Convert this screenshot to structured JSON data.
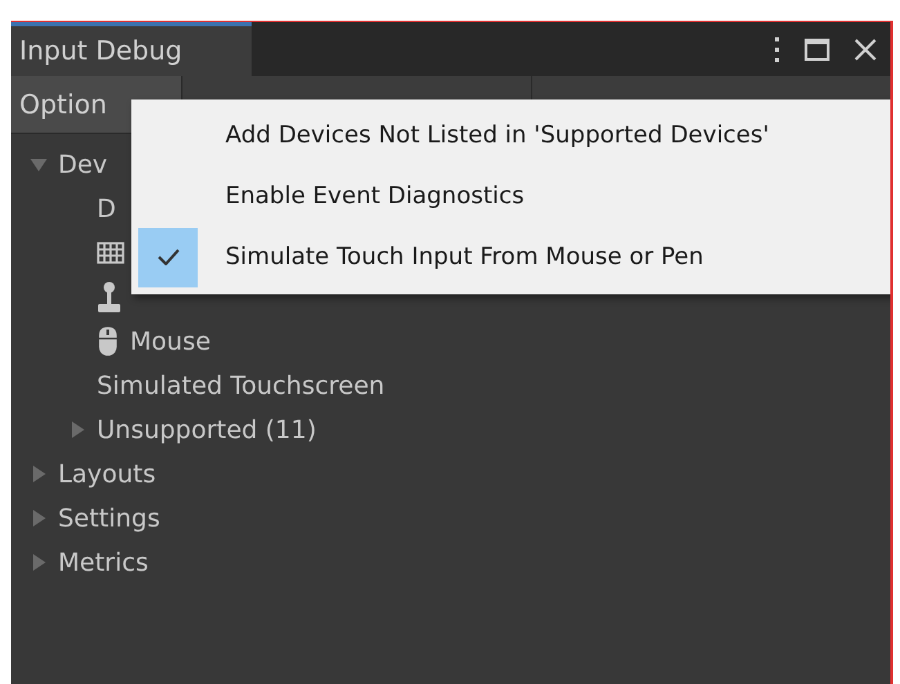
{
  "window": {
    "tab": "Input Debug"
  },
  "window_controls": [
    {
      "kind": "more"
    },
    {
      "kind": "maximize"
    },
    {
      "kind": "close"
    }
  ],
  "toolbar": {
    "buttons": [
      {
        "label": "Option"
      }
    ]
  },
  "tree": [
    {
      "label": "Dev",
      "expanded": true,
      "children": [
        {
          "label": "D"
        },
        {
          "kind": "keyboard"
        },
        {
          "kind": "joystick"
        },
        {
          "kind": "mouse",
          "label": "Mouse"
        },
        {
          "label": "Simulated Touchscreen"
        },
        {
          "label": "Unsupported (11)",
          "expanded": false
        }
      ]
    },
    {
      "label": "Layouts",
      "expanded": false
    },
    {
      "label": "Settings",
      "expanded": false
    },
    {
      "label": "Metrics",
      "expanded": false
    }
  ],
  "menu": [
    {
      "label": "Add Devices Not Listed in 'Supported Devices'",
      "checked": false
    },
    {
      "label": "Enable Event Diagnostics",
      "checked": false
    },
    {
      "label": "Simulate Touch Input From Mouse or Pen",
      "checked": true
    }
  ]
}
